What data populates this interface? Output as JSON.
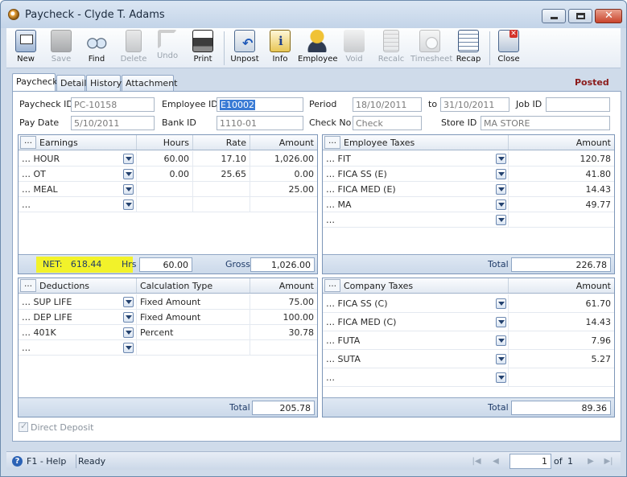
{
  "window": {
    "title": "Paycheck - Clyde T. Adams"
  },
  "toolbar": {
    "new": "New",
    "save": "Save",
    "find": "Find",
    "delete": "Delete",
    "undo": "Undo",
    "print": "Print",
    "unpost": "Unpost",
    "info": "Info",
    "employee": "Employee",
    "void": "Void",
    "recalc": "Recalc",
    "timesheet": "Timesheet",
    "recap": "Recap",
    "close": "Close"
  },
  "tabs": [
    "Paycheck",
    "Detail",
    "History",
    "Attachment"
  ],
  "status_badge": "Posted",
  "header": {
    "paycheck_id_label": "Paycheck ID",
    "paycheck_id": "PC-10158",
    "employee_id_label": "Employee ID",
    "employee_id": "E10002",
    "period_label": "Period",
    "period_from": "18/10/2011",
    "period_to_label": "to",
    "period_to": "31/10/2011",
    "job_id_label": "Job ID",
    "job_id": "",
    "pay_date_label": "Pay Date",
    "pay_date": "5/10/2011",
    "bank_id_label": "Bank ID",
    "bank_id": "1110-01",
    "check_no_label": "Check No",
    "check_no_placeholder": "Check",
    "store_id_label": "Store ID",
    "store_id": "MA STORE"
  },
  "earnings": {
    "columns": [
      "Earnings",
      "Hours",
      "Rate",
      "Amount"
    ],
    "rows": [
      {
        "name": "HOUR",
        "hours": "60.00",
        "rate": "17.10",
        "amount": "1,026.00"
      },
      {
        "name": "OT",
        "hours": "0.00",
        "rate": "25.65",
        "amount": "0.00"
      },
      {
        "name": "MEAL",
        "hours": "",
        "rate": "",
        "amount": "25.00"
      },
      {
        "name": "",
        "hours": "",
        "rate": "",
        "amount": ""
      }
    ],
    "net_label": "NET:",
    "net_value": "618.44",
    "hrs_label": "Hrs",
    "hrs_value": "60.00",
    "gross_label": "Gross",
    "gross_value": "1,026.00"
  },
  "employee_taxes": {
    "columns": [
      "Employee Taxes",
      "Amount"
    ],
    "rows": [
      {
        "name": "FIT",
        "amount": "120.78"
      },
      {
        "name": "FICA SS (E)",
        "amount": "41.80"
      },
      {
        "name": "FICA MED (E)",
        "amount": "14.43"
      },
      {
        "name": "MA",
        "amount": "49.77"
      },
      {
        "name": "",
        "amount": ""
      }
    ],
    "total_label": "Total",
    "total_value": "226.78"
  },
  "deductions": {
    "columns": [
      "Deductions",
      "Calculation Type",
      "Amount"
    ],
    "rows": [
      {
        "name": "SUP LIFE",
        "calc": "Fixed Amount",
        "amount": "75.00"
      },
      {
        "name": "DEP LIFE",
        "calc": "Fixed Amount",
        "amount": "100.00"
      },
      {
        "name": "401K",
        "calc": "Percent",
        "amount": "30.78"
      },
      {
        "name": "",
        "calc": "",
        "amount": ""
      }
    ],
    "total_label": "Total",
    "total_value": "205.78"
  },
  "company_taxes": {
    "columns": [
      "Company Taxes",
      "Amount"
    ],
    "rows": [
      {
        "name": "FICA SS (C)",
        "amount": "61.70"
      },
      {
        "name": "FICA MED (C)",
        "amount": "14.43"
      },
      {
        "name": "FUTA",
        "amount": "7.96"
      },
      {
        "name": "SUTA",
        "amount": "5.27"
      },
      {
        "name": "",
        "amount": ""
      }
    ],
    "total_label": "Total",
    "total_value": "89.36"
  },
  "direct_deposit_label": "Direct Deposit",
  "statusbar": {
    "help": "F1 - Help",
    "status": "Ready",
    "page": "1",
    "of_label": "of",
    "page_total": "1"
  },
  "ellipsis": "…",
  "colors": {
    "net_highlight": "#f2f22a",
    "posted": "#8b1b1b",
    "selection": "#3a7bd5"
  }
}
